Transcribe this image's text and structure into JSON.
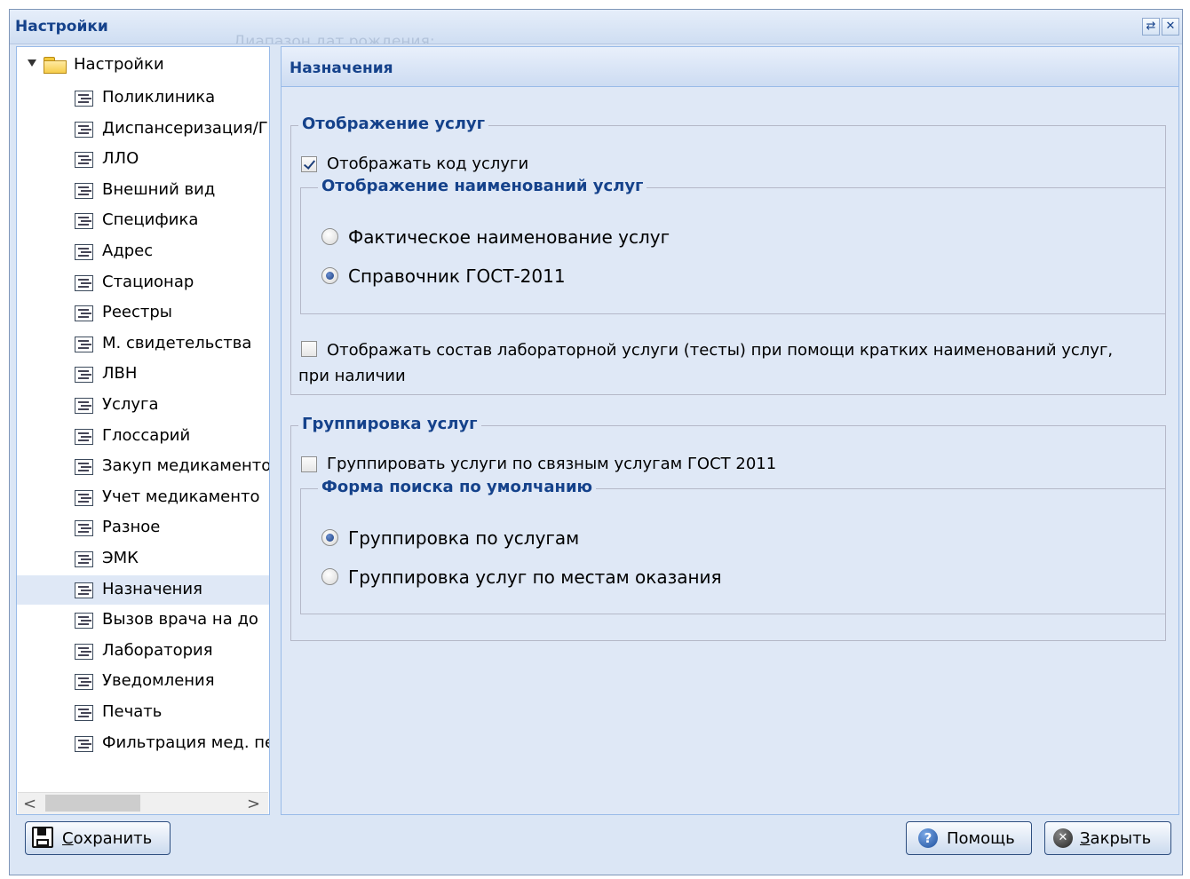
{
  "window": {
    "title": "Настройки",
    "ghost_text": "Диапазон дат рождения:",
    "tool_refresh": "⇄",
    "tool_close": "✕"
  },
  "tree": {
    "root_label": "Настройки",
    "items": [
      {
        "label": "Поликлиника"
      },
      {
        "label": "Диспансеризация/Г"
      },
      {
        "label": "ЛЛО"
      },
      {
        "label": "Внешний вид"
      },
      {
        "label": "Специфика"
      },
      {
        "label": "Адрес"
      },
      {
        "label": "Стационар"
      },
      {
        "label": "Реестры"
      },
      {
        "label": "М. свидетельства"
      },
      {
        "label": "ЛВН"
      },
      {
        "label": "Услуга"
      },
      {
        "label": "Глоссарий"
      },
      {
        "label": "Закуп медикаменто"
      },
      {
        "label": "Учет медикаменто"
      },
      {
        "label": "Разное"
      },
      {
        "label": "ЭМК"
      },
      {
        "label": "Назначения",
        "selected": true
      },
      {
        "label": "Вызов врача на до"
      },
      {
        "label": "Лаборатория"
      },
      {
        "label": "Уведомления"
      },
      {
        "label": "Печать"
      },
      {
        "label": "Фильтрация мед. пе"
      }
    ],
    "scroll_left": "<",
    "scroll_right": ">"
  },
  "panel": {
    "title": "Назначения",
    "display_group": {
      "legend": "Отображение услуг",
      "show_code": {
        "label": "Отображать код услуги",
        "checked": true
      },
      "names_group": {
        "legend": "Отображение наименований услуг",
        "opt_actual": {
          "label": "Фактическое наименование услуг",
          "selected": false
        },
        "opt_gost": {
          "label": "Справочник ГОСТ-2011",
          "selected": true
        }
      },
      "lab_short": {
        "label_line1": "Отображать состав лабораторной услуги (тесты) при помощи кратких наименований услуг,",
        "label_line2": "при наличии",
        "checked": false
      }
    },
    "grouping_group": {
      "legend": "Группировка услуг",
      "group_gost": {
        "label": "Группировать услуги по связным услугам ГОСТ 2011",
        "checked": false
      },
      "search_form": {
        "legend": "Форма поиска по умолчанию",
        "opt_services": {
          "label": "Группировка по услугам",
          "selected": true
        },
        "opt_places": {
          "label": "Группировка услуг по местам оказания",
          "selected": false
        }
      }
    }
  },
  "buttons": {
    "save_first": "С",
    "save_rest": "охранить",
    "help": "Помощь",
    "close_first": "З",
    "close_rest": "акрыть",
    "help_glyph": "?",
    "close_glyph": "✕"
  },
  "colors": {
    "title_text": "#15428b",
    "panel_bg": "#dfe8f6",
    "border": "#99bbe8",
    "selection": "#dfe8f6"
  }
}
